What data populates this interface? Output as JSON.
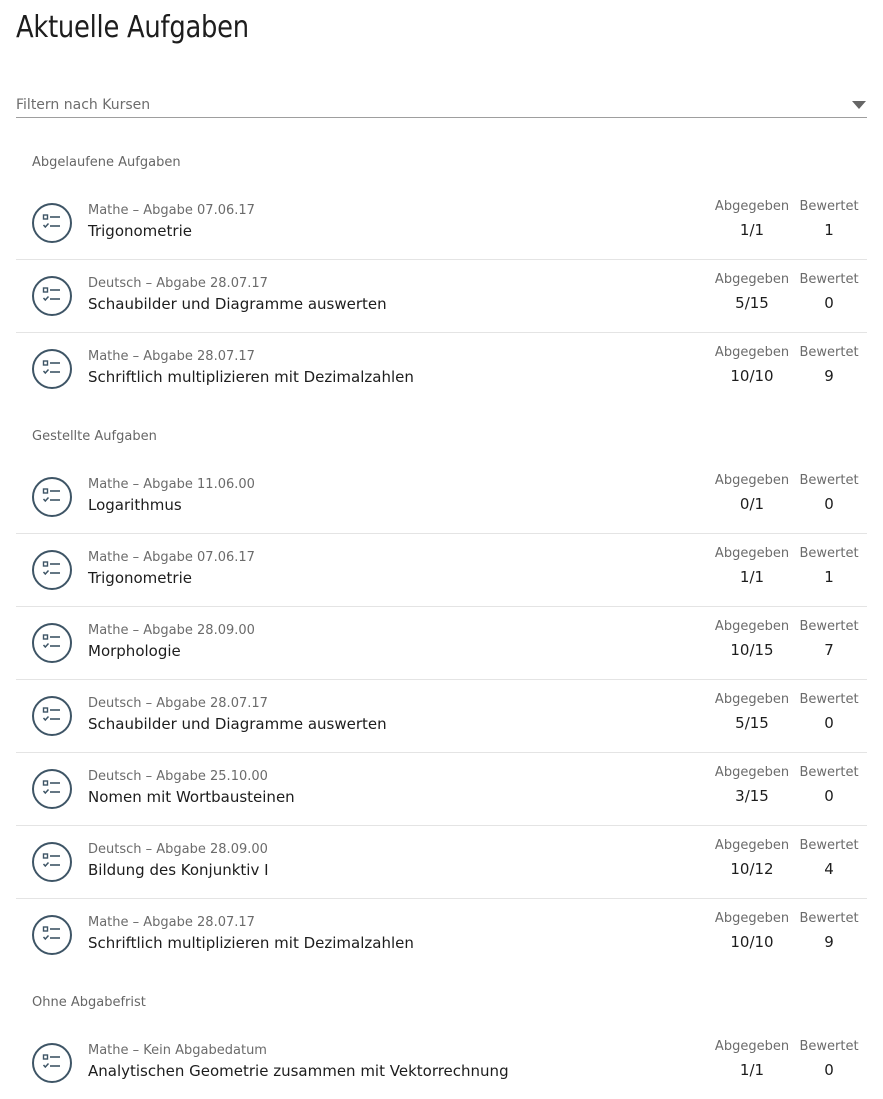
{
  "page": {
    "title": "Aktuelle Aufgaben"
  },
  "filter": {
    "placeholder": "Filtern nach Kursen"
  },
  "labels": {
    "submitted": "Abgegeben",
    "graded": "Bewertet"
  },
  "sections": [
    {
      "title": "Abgelaufene Aufgaben",
      "tasks": [
        {
          "meta": "Mathe – Abgabe 07.06.17",
          "name": "Trigonometrie",
          "submitted": "1/1",
          "graded": "1"
        },
        {
          "meta": "Deutsch – Abgabe 28.07.17",
          "name": "Schaubilder und Diagramme auswerten",
          "submitted": "5/15",
          "graded": "0"
        },
        {
          "meta": "Mathe – Abgabe 28.07.17",
          "name": "Schriftlich multiplizieren mit Dezimalzahlen",
          "submitted": "10/10",
          "graded": "9"
        }
      ]
    },
    {
      "title": "Gestellte Aufgaben",
      "tasks": [
        {
          "meta": "Mathe – Abgabe 11.06.00",
          "name": "Logarithmus",
          "submitted": "0/1",
          "graded": "0"
        },
        {
          "meta": "Mathe – Abgabe 07.06.17",
          "name": "Trigonometrie",
          "submitted": "1/1",
          "graded": "1"
        },
        {
          "meta": "Mathe – Abgabe 28.09.00",
          "name": "Morphologie",
          "submitted": "10/15",
          "graded": "7"
        },
        {
          "meta": "Deutsch – Abgabe 28.07.17",
          "name": "Schaubilder und Diagramme auswerten",
          "submitted": "5/15",
          "graded": "0"
        },
        {
          "meta": "Deutsch – Abgabe 25.10.00",
          "name": "Nomen mit Wortbausteinen",
          "submitted": "3/15",
          "graded": "0"
        },
        {
          "meta": "Deutsch – Abgabe 28.09.00",
          "name": "Bildung des Konjunktiv I",
          "submitted": "10/12",
          "graded": "4"
        },
        {
          "meta": "Mathe – Abgabe 28.07.17",
          "name": "Schriftlich multiplizieren mit Dezimalzahlen",
          "submitted": "10/10",
          "graded": "9"
        }
      ]
    },
    {
      "title": "Ohne Abgabefrist",
      "tasks": [
        {
          "meta": "Mathe – Kein Abgabedatum",
          "name": "Analytischen Geometrie zusammen mit Vektorrechnung",
          "submitted": "1/1",
          "graded": "0"
        }
      ]
    }
  ],
  "icons": {
    "task": "task-checklist-icon",
    "dropdown": "chevron-down-icon"
  },
  "colors": {
    "icon": "#3e5566",
    "divider": "#e4e4e4"
  }
}
